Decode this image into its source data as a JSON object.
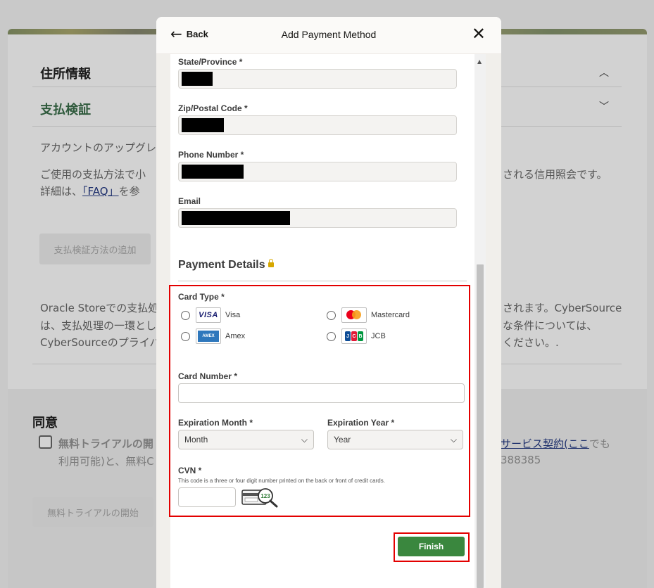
{
  "background": {
    "address_heading": "住所情報",
    "payment_verification_heading": "支払検証",
    "upgrade_text": "アカウントのアップグレ",
    "payment_text_line1_left": "ご使用の支払方法で小",
    "payment_text_line1_right": "される信用照会です。",
    "payment_text_line2_prefix": "詳細は、",
    "faq_link": "「FAQ」",
    "payment_text_line2_suffix": "を参",
    "add_verification_button": "支払検証方法の追加",
    "oracle_line1_left": "Oracle Storeでの支払処",
    "oracle_line1_right": "されます。CyberSource",
    "oracle_line2_left": "は、支払処理の一環とし",
    "oracle_line2_right": "な条件については、",
    "oracle_line3_left": "CyberSourceのプライバ",
    "oracle_line3_right": "ください。.",
    "consent_heading": "同意",
    "consent_line1_left": "無料トライアルの開",
    "consent_link_services": "サービス契約",
    "consent_link_here": "(ここ",
    "consent_line1_right": "でも",
    "consent_line2_left": "利用可能)と、無料C",
    "consent_line2_right": "388385",
    "start_trial_button": "無料トライアルの開始"
  },
  "modal": {
    "back_label": "Back",
    "title": "Add Payment Method",
    "fields": {
      "state": {
        "label": "State/Province *"
      },
      "zip": {
        "label": "Zip/Postal Code *"
      },
      "phone": {
        "label": "Phone Number *"
      },
      "email": {
        "label": "Email"
      }
    },
    "payment_details_title": "Payment Details",
    "card_type_label": "Card Type *",
    "card_types": {
      "visa": "Visa",
      "mastercard": "Mastercard",
      "amex": "Amex",
      "jcb": "JCB"
    },
    "card_logos": {
      "visa": "VISA",
      "amex": "AMEX",
      "jcb": "JCB"
    },
    "card_number_label": "Card Number *",
    "expiration_month_label": "Expiration Month *",
    "expiration_month_value": "Month",
    "expiration_year_label": "Expiration Year *",
    "expiration_year_value": "Year",
    "cvn_label": "CVN *",
    "cvn_help": "This code is a three or four digit number printed on the back or front of credit cards.",
    "cvn_image_digits": "123",
    "finish_button": "Finish"
  },
  "colors": {
    "finish_button": "#3a873e",
    "highlight_box": "#e30000",
    "heading_green": "#2f5a3c"
  }
}
